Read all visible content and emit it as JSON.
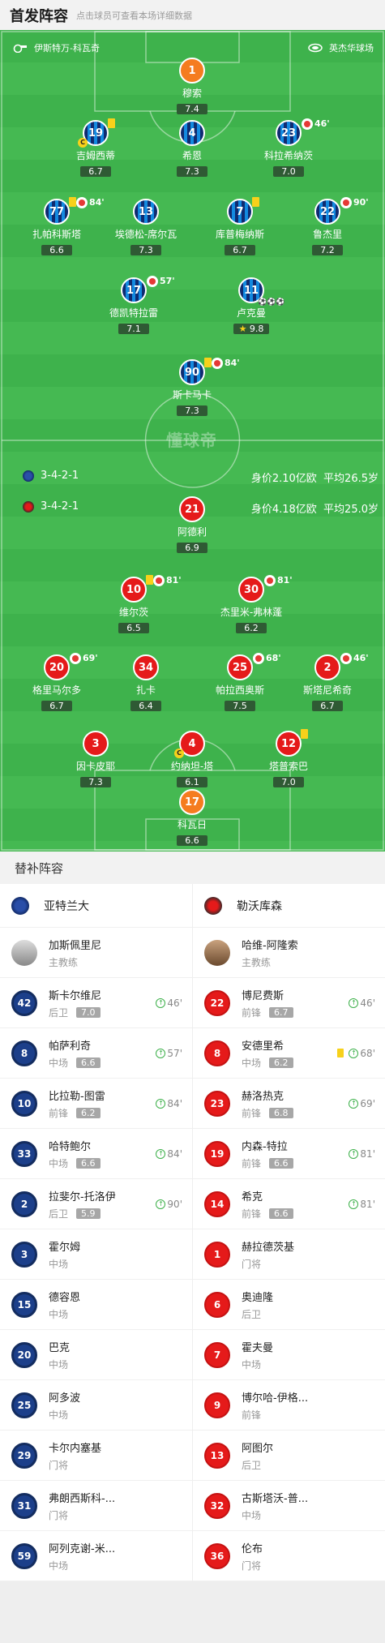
{
  "header": {
    "title": "首发阵容",
    "subtitle": "点击球员可查看本场详细数据"
  },
  "pitch": {
    "top_venue": "伊斯特万-科瓦奇",
    "top_stadium": "英杰华球场",
    "watermark": "懂球帝",
    "atalanta_formation": "3-4-2-1",
    "atalanta_value": "身价2.10亿欧",
    "atalanta_age": "平均26.5岁",
    "leverkusen_formation": "3-4-2-1",
    "leverkusen_value": "身价4.18亿欧",
    "leverkusen_age": "平均25.0岁",
    "players": [
      {
        "num": "1",
        "name": "穆索",
        "rating": "7.4",
        "kit": "orange"
      },
      {
        "num": "19",
        "name": "吉姆西蒂",
        "rating": "6.7",
        "kit": "blue",
        "yellow": true,
        "captain": true
      },
      {
        "num": "4",
        "name": "希恩",
        "rating": "7.3",
        "kit": "blue"
      },
      {
        "num": "23",
        "name": "科拉希纳茨",
        "rating": "7.0",
        "kit": "blue",
        "sub": "46'"
      },
      {
        "num": "77",
        "name": "扎帕科斯塔",
        "rating": "6.6",
        "kit": "blue",
        "yellow": true,
        "sub": "84'"
      },
      {
        "num": "13",
        "name": "埃德松-席尔瓦",
        "rating": "7.3",
        "kit": "blue"
      },
      {
        "num": "7",
        "name": "库普梅纳斯",
        "rating": "6.7",
        "kit": "blue",
        "yellow": true
      },
      {
        "num": "22",
        "name": "鲁杰里",
        "rating": "7.2",
        "kit": "blue",
        "sub": "90'"
      },
      {
        "num": "17",
        "name": "德凯特拉雷",
        "rating": "7.1",
        "kit": "blue",
        "sub": "57'"
      },
      {
        "num": "11",
        "name": "卢克曼",
        "rating": "9.8",
        "kit": "blue",
        "goals": "⚽⚽⚽",
        "star": true
      },
      {
        "num": "90",
        "name": "斯卡马卡",
        "rating": "7.3",
        "kit": "blue",
        "yellow": true,
        "sub": "84'"
      },
      {
        "num": "21",
        "name": "阿德利",
        "rating": "6.9",
        "kit": "red"
      },
      {
        "num": "10",
        "name": "维尔茨",
        "rating": "6.5",
        "kit": "red",
        "yellow": true,
        "sub": "81'"
      },
      {
        "num": "30",
        "name": "杰里米-弗林蓬",
        "rating": "6.2",
        "kit": "red",
        "sub": "81'"
      },
      {
        "num": "20",
        "name": "格里马尔多",
        "rating": "6.7",
        "kit": "red",
        "sub": "69'"
      },
      {
        "num": "34",
        "name": "扎卡",
        "rating": "6.4",
        "kit": "red"
      },
      {
        "num": "25",
        "name": "帕拉西奥斯",
        "rating": "7.5",
        "kit": "red",
        "sub": "68'"
      },
      {
        "num": "2",
        "name": "斯塔尼希奇",
        "rating": "6.7",
        "kit": "red",
        "sub": "46'"
      },
      {
        "num": "3",
        "name": "因卡皮耶",
        "rating": "7.3",
        "kit": "red"
      },
      {
        "num": "4",
        "name": "约纳坦-塔",
        "rating": "6.1",
        "kit": "red",
        "captain": true
      },
      {
        "num": "12",
        "name": "塔普索巴",
        "rating": "7.0",
        "kit": "red",
        "yellow": true
      },
      {
        "num": "17",
        "name": "科瓦日",
        "rating": "6.6",
        "kit": "orange"
      }
    ]
  },
  "subs": {
    "title": "替补阵容",
    "left_team": "亚特兰大",
    "right_team": "勒沃库森",
    "left_coach": {
      "name": "加斯佩里尼",
      "role": "主教练"
    },
    "right_coach": {
      "name": "哈维-阿隆索",
      "role": "主教练"
    },
    "left": [
      {
        "num": "42",
        "name": "斯卡尔维尼",
        "pos": "后卫",
        "rating": "7.0",
        "in": "46'"
      },
      {
        "num": "8",
        "name": "帕萨利奇",
        "pos": "中场",
        "rating": "6.6",
        "in": "57'"
      },
      {
        "num": "10",
        "name": "比拉勒-图雷",
        "pos": "前锋",
        "rating": "6.2",
        "in": "84'"
      },
      {
        "num": "33",
        "name": "哈特鲍尔",
        "pos": "中场",
        "rating": "6.6",
        "in": "84'"
      },
      {
        "num": "2",
        "name": "拉斐尔-托洛伊",
        "pos": "后卫",
        "rating": "5.9",
        "in": "90'"
      },
      {
        "num": "3",
        "name": "霍尔姆",
        "pos": "中场"
      },
      {
        "num": "15",
        "name": "德容恩",
        "pos": "中场"
      },
      {
        "num": "20",
        "name": "巴克",
        "pos": "中场"
      },
      {
        "num": "25",
        "name": "阿多波",
        "pos": "中场"
      },
      {
        "num": "29",
        "name": "卡尔内塞基",
        "pos": "门将"
      },
      {
        "num": "31",
        "name": "弗朗西斯科-...",
        "pos": "门将"
      },
      {
        "num": "59",
        "name": "阿列克谢-米...",
        "pos": "中场"
      }
    ],
    "right": [
      {
        "num": "22",
        "name": "博尼费斯",
        "pos": "前锋",
        "rating": "6.7",
        "in": "46'"
      },
      {
        "num": "8",
        "name": "安德里希",
        "pos": "中场",
        "rating": "6.2",
        "in": "68'",
        "yellow": true
      },
      {
        "num": "23",
        "name": "赫洛热克",
        "pos": "前锋",
        "rating": "6.8",
        "in": "69'"
      },
      {
        "num": "19",
        "name": "内森-特拉",
        "pos": "前锋",
        "rating": "6.6",
        "in": "81'"
      },
      {
        "num": "14",
        "name": "希克",
        "pos": "前锋",
        "rating": "6.6",
        "in": "81'"
      },
      {
        "num": "1",
        "name": "赫拉德茨基",
        "pos": "门将"
      },
      {
        "num": "6",
        "name": "奥迪隆",
        "pos": "后卫"
      },
      {
        "num": "7",
        "name": "霍夫曼",
        "pos": "中场"
      },
      {
        "num": "9",
        "name": "博尔哈-伊格...",
        "pos": "前锋"
      },
      {
        "num": "13",
        "name": "阿图尔",
        "pos": "后卫"
      },
      {
        "num": "32",
        "name": "古斯塔沃-普...",
        "pos": "中场"
      },
      {
        "num": "36",
        "name": "伦布",
        "pos": "门将"
      }
    ]
  }
}
